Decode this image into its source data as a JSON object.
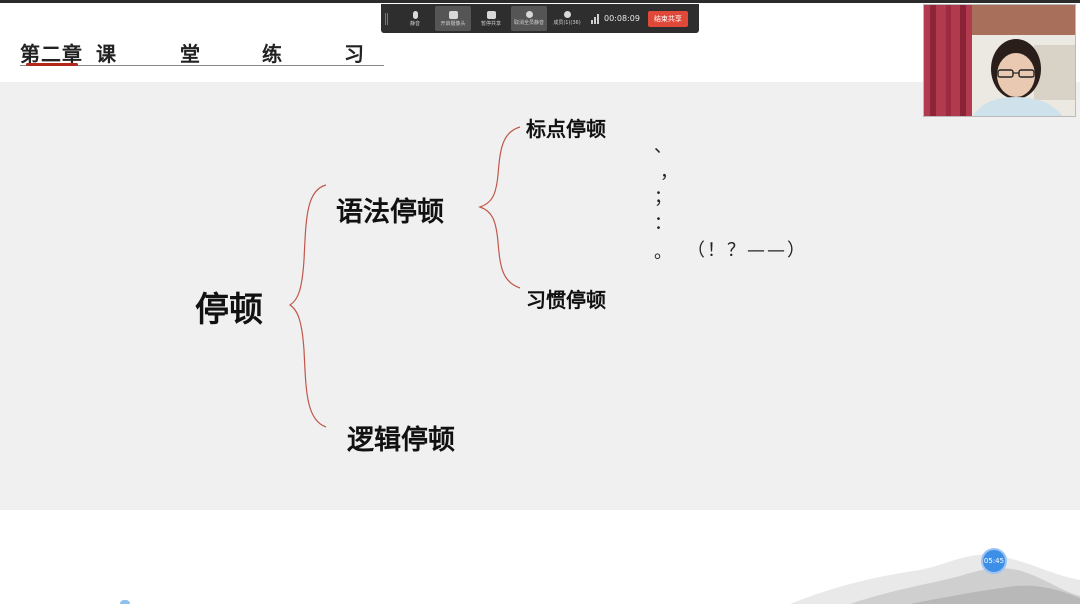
{
  "meeting_toolbar": {
    "buttons": [
      {
        "label": "静音",
        "icon": "microphone-icon"
      },
      {
        "label": "开启摄像头",
        "icon": "camera-icon"
      },
      {
        "label": "暂停共享",
        "icon": "pause-share-icon"
      },
      {
        "label": "取消全员静音",
        "icon": "mute-all-icon"
      },
      {
        "label": "成员(1)(36)",
        "icon": "members-icon"
      }
    ],
    "elapsed_time": "00:08:09",
    "end_share_label": "结束共享"
  },
  "slide": {
    "chapter_title": [
      "第二章",
      "课",
      "堂",
      "练",
      "习"
    ],
    "mindmap": {
      "root": "停顿",
      "grammar_pause": "语法停顿",
      "logic_pause": "逻辑停顿",
      "punctuation_pause": "标点停顿",
      "habit_pause": "习惯停顿",
      "punctuation_marks": [
        "、",
        "，",
        "；",
        "：",
        "。",
        "（！？——）"
      ]
    }
  },
  "overlay": {
    "time_badge": "05:45"
  },
  "colors": {
    "title_underline_accent": "#b4281c",
    "brace_color": "#c0574a",
    "toolbar_bg": "#2e2e2e",
    "end_share_bg": "#e0483a",
    "badge_bg": "#3d8ee6"
  }
}
